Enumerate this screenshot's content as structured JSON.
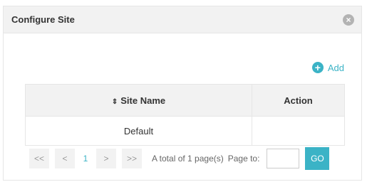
{
  "dialog": {
    "title": "Configure Site",
    "close_icon": "×"
  },
  "toolbar": {
    "add_icon": "+",
    "add_label": "Add"
  },
  "table": {
    "sort_icon": "⇕",
    "headers": [
      "Site Name",
      "Action"
    ],
    "rows": [
      [
        "Default",
        ""
      ]
    ]
  },
  "pagination": {
    "first": "<<",
    "prev": "<",
    "current": "1",
    "next": ">",
    "last": ">>",
    "total_text": "A total of 1 page(s)",
    "page_to_label": "Page to:",
    "page_input_value": "",
    "go_label": "GO"
  },
  "colors": {
    "accent": "#3bb3c6",
    "header_bg": "#f2f2f2"
  }
}
